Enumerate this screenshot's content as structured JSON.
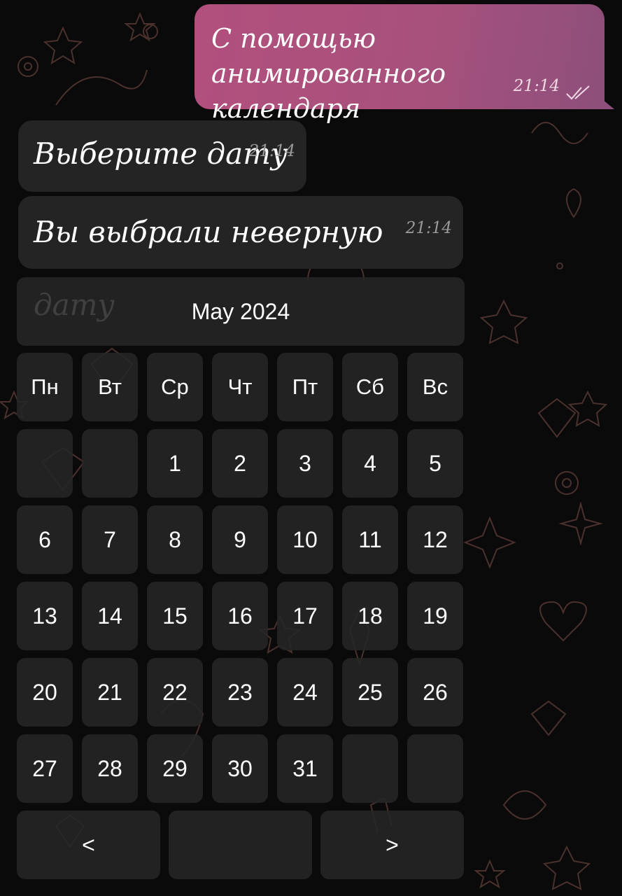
{
  "chat": {
    "outgoing": {
      "text": "С помощью анимированного календаря",
      "time": "21:14"
    },
    "incoming": [
      {
        "text": "Выберите дату",
        "time": "21:14"
      },
      {
        "text": "Вы выбрали неверную дату",
        "time": "21:14"
      }
    ]
  },
  "calendar": {
    "month_label": "May 2024",
    "weekdays": [
      "Пн",
      "Вт",
      "Ср",
      "Чт",
      "Пт",
      "Сб",
      "Вс"
    ],
    "weeks": [
      [
        "",
        "",
        "1",
        "2",
        "3",
        "4",
        "5"
      ],
      [
        "6",
        "7",
        "8",
        "9",
        "10",
        "11",
        "12"
      ],
      [
        "13",
        "14",
        "15",
        "16",
        "17",
        "18",
        "19"
      ],
      [
        "20",
        "21",
        "22",
        "23",
        "24",
        "25",
        "26"
      ],
      [
        "27",
        "28",
        "29",
        "30",
        "31",
        "",
        ""
      ]
    ],
    "nav": {
      "prev": "<",
      "middle": "",
      "next": ">"
    }
  },
  "colors": {
    "outgoing_bubble": "#a8517c",
    "incoming_bubble": "#242424",
    "button": "#262626",
    "background": "#0a0a0a",
    "doodle": "#5a3a3a"
  }
}
